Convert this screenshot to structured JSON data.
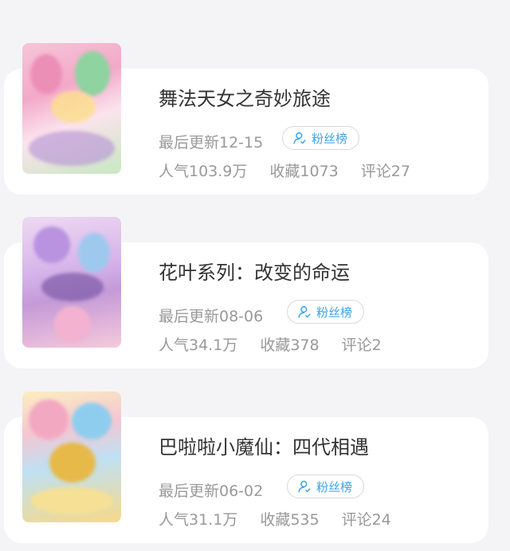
{
  "items": [
    {
      "title": "舞法天女之奇妙旅途",
      "update": "最后更新12-15",
      "fans_label": "粉丝榜",
      "popularity": "人气103.9万",
      "favorites": "收藏1073",
      "comments": "评论27",
      "cover_colors": [
        "#f6c6d6",
        "#e8a3c6",
        "#9fd6a8",
        "#f7e0b5"
      ]
    },
    {
      "title": "花叶系列：改变的命运",
      "update": "最后更新08-06",
      "fans_label": "粉丝榜",
      "popularity": "人气34.1万",
      "favorites": "收藏378",
      "comments": "评论2",
      "cover_colors": [
        "#e7c9ee",
        "#c9a4e0",
        "#f5b7d2",
        "#b7d7f0"
      ]
    },
    {
      "title": "巴啦啦小魔仙：四代相遇",
      "update": "最后更新06-02",
      "fans_label": "粉丝榜",
      "popularity": "人气31.1万",
      "favorites": "收藏535",
      "comments": "评论24",
      "cover_colors": [
        "#f8e7a6",
        "#f2b7c8",
        "#a9d6f2",
        "#e3c06a"
      ]
    }
  ]
}
